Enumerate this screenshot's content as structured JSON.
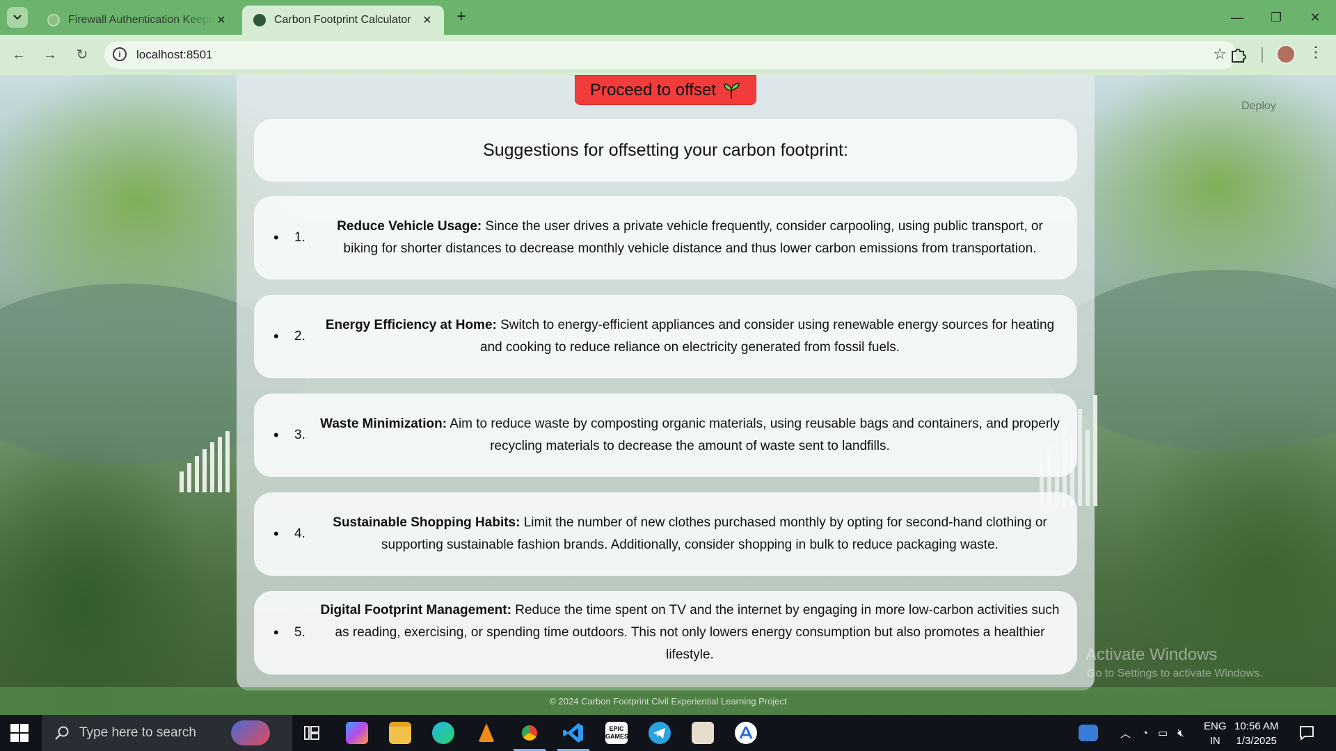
{
  "browser": {
    "tabs": [
      {
        "title": "Firewall Authentication Keepaliv",
        "active": false
      },
      {
        "title": "Carbon Footprint Calculator",
        "active": true
      }
    ],
    "url": "localhost:8501"
  },
  "app": {
    "proceed_label": "Proceed to offset",
    "heading": "Suggestions for offsetting your carbon footprint:",
    "suggestions": [
      {
        "number": "1.",
        "title": "Reduce Vehicle Usage:",
        "text": " Since the user drives a private vehicle frequently, consider carpooling, using public transport, or biking for shorter distances to decrease monthly vehicle distance and thus lower carbon emissions from transportation."
      },
      {
        "number": "2.",
        "title": "Energy Efficiency at Home:",
        "text": " Switch to energy-efficient appliances and consider using renewable energy sources for heating and cooking to reduce reliance on electricity generated from fossil fuels."
      },
      {
        "number": "3.",
        "title": "Waste Minimization:",
        "text": " Aim to reduce waste by composting organic materials, using reusable bags and containers, and properly recycling materials to decrease the amount of waste sent to landfills."
      },
      {
        "number": "4.",
        "title": "Sustainable Shopping Habits:",
        "text": " Limit the number of new clothes purchased monthly by opting for second-hand clothing or supporting sustainable fashion brands. Additionally, consider shopping in bulk to reduce packaging waste."
      },
      {
        "number": "5.",
        "title": "Digital Footprint Management:",
        "text": " Reduce the time spent on TV and the internet by engaging in more low-carbon activities such as reading, exercising, or spending time outdoors. This not only lowers energy consumption but also promotes a healthier lifestyle."
      }
    ],
    "deploy_label": "Deploy",
    "footer": "© 2024 Carbon Footprint Civil Experiential Learning Project",
    "watermark_title": "Activate Windows",
    "watermark_sub": "Go to Settings to activate Windows."
  },
  "taskbar": {
    "search_placeholder": "Type here to search",
    "lang_line1": "ENG",
    "lang_line2": "IN",
    "time": "10:56 AM",
    "date": "1/3/2025"
  }
}
